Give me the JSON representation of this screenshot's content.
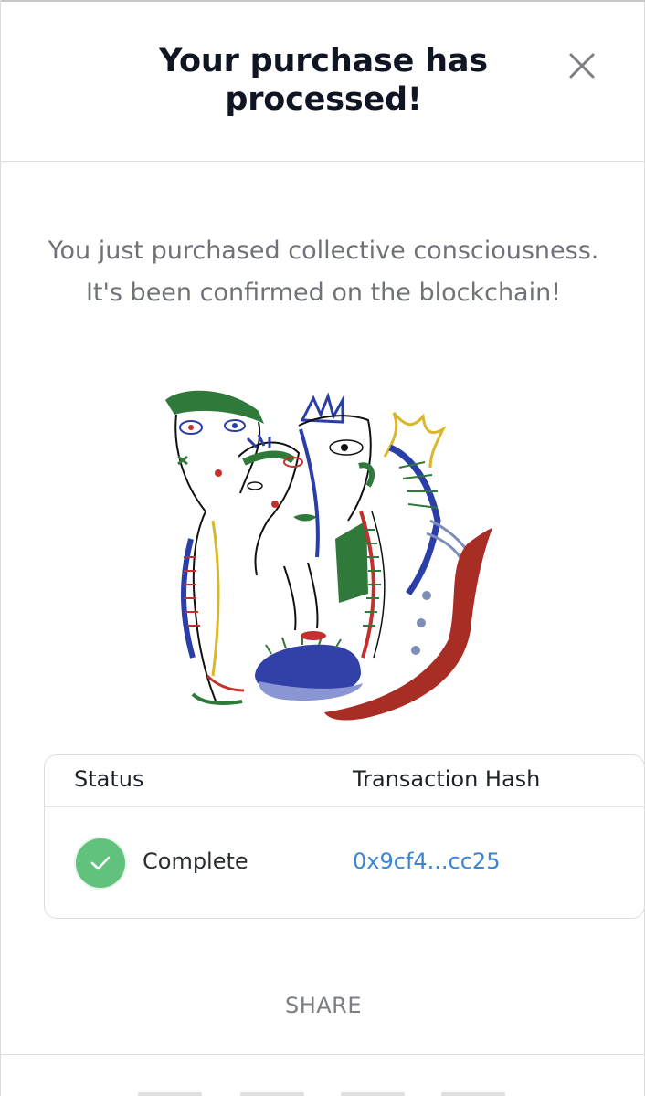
{
  "dialog": {
    "title": "Your purchase has processed!",
    "message": "You just purchased collective consciousness. It's been confirmed on the blockchain!",
    "close_icon": "close-icon",
    "artwork_icon": "nft-artwork"
  },
  "transaction": {
    "status_header": "Status",
    "hash_header": "Transaction Hash",
    "status_value": "Complete",
    "hash_value": "0x9cf4...cc25",
    "status_icon": "check-icon",
    "status_color": "#60c27d",
    "link_color": "#3a86d4"
  },
  "actions": {
    "share_label": "SHARE"
  }
}
